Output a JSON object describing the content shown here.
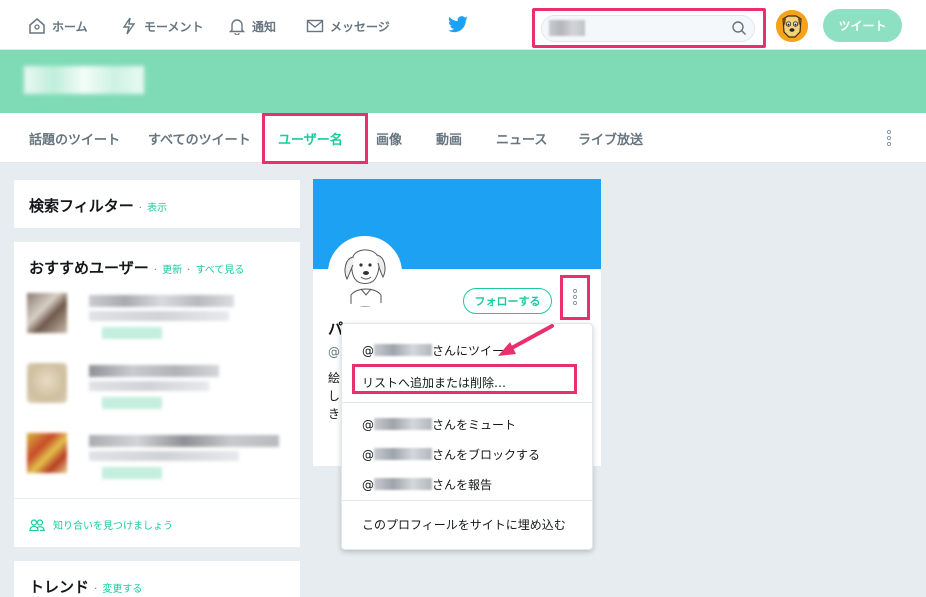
{
  "nav": {
    "home": "ホーム",
    "moments": "モーメント",
    "notifications": "通知",
    "messages": "メッセージ",
    "tweet_button": "ツイート"
  },
  "search": {
    "placeholder": ""
  },
  "tabs": [
    {
      "label": "話題のツイート"
    },
    {
      "label": "すべてのツイート"
    },
    {
      "label": "ユーザー名"
    },
    {
      "label": "画像"
    },
    {
      "label": "動画"
    },
    {
      "label": "ニュース"
    },
    {
      "label": "ライブ放送"
    }
  ],
  "filters": {
    "title": "検索フィルター",
    "sep": "·",
    "link": "表示"
  },
  "suggest": {
    "title": "おすすめユーザー",
    "sep1": "·",
    "refresh": "更新",
    "sep2": "·",
    "view_all": "すべて見る",
    "find_friends": "知り合いを見つけましょう"
  },
  "trends": {
    "title": "トレンド",
    "sep": "·",
    "change": "変更する"
  },
  "profile": {
    "follow": "フォローする",
    "name": "パ",
    "at": "@",
    "bio": "絵しき"
  },
  "menu": {
    "at": "@",
    "tweet_to": "さんにツイー",
    "list": "リストへ追加または削除…",
    "mute": "さんをミュート",
    "block": "さんをブロックする",
    "report": "さんを報告",
    "embed": "このプロフィールをサイトに埋め込む"
  },
  "colors": {
    "accent": "#1dcaa0",
    "highlight": "#e8306f",
    "banner": "#7fdbb6",
    "profile_banner": "#1da1f2"
  }
}
